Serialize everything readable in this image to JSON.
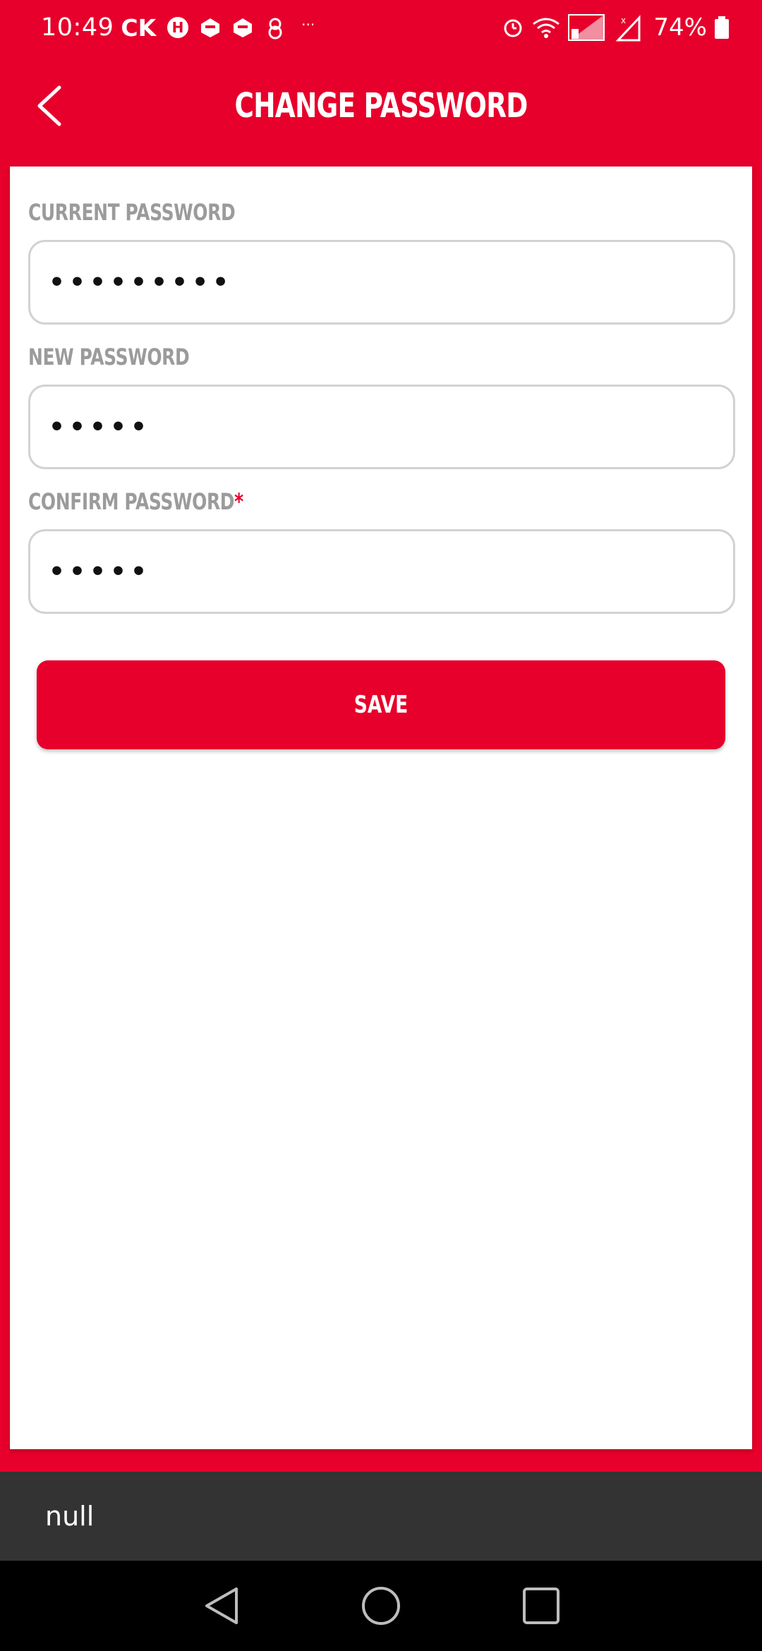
{
  "status_bar": {
    "time": "10:49",
    "carrier": "CK",
    "battery_percent": "74%",
    "left_icons": [
      "hanime-icon",
      "app-icon",
      "app-icon",
      "baby-icon"
    ],
    "overflow": "···",
    "right_icons": [
      "alarm-icon",
      "wifi-icon",
      "signal-sim1-icon",
      "signal-sim2-icon",
      "battery-icon"
    ]
  },
  "app_bar": {
    "title": "CHANGE PASSWORD",
    "back_icon": "chevron-left-icon"
  },
  "form": {
    "current_password": {
      "label": "CURRENT PASSWORD",
      "value": "•••••••••"
    },
    "new_password": {
      "label": "NEW PASSWORD",
      "value": "•••••"
    },
    "confirm_password": {
      "label": "CONFIRM PASSWORD",
      "required_mark": "*",
      "value": "•••••"
    },
    "save_label": "SAVE"
  },
  "toast": {
    "text": "null"
  },
  "nav_bar": {
    "icons": [
      "back-triangle-icon",
      "home-circle-icon",
      "recents-square-icon"
    ]
  },
  "colors": {
    "brand": "#e7002b",
    "label": "#9b9b9b",
    "toast_bg": "#333333"
  }
}
